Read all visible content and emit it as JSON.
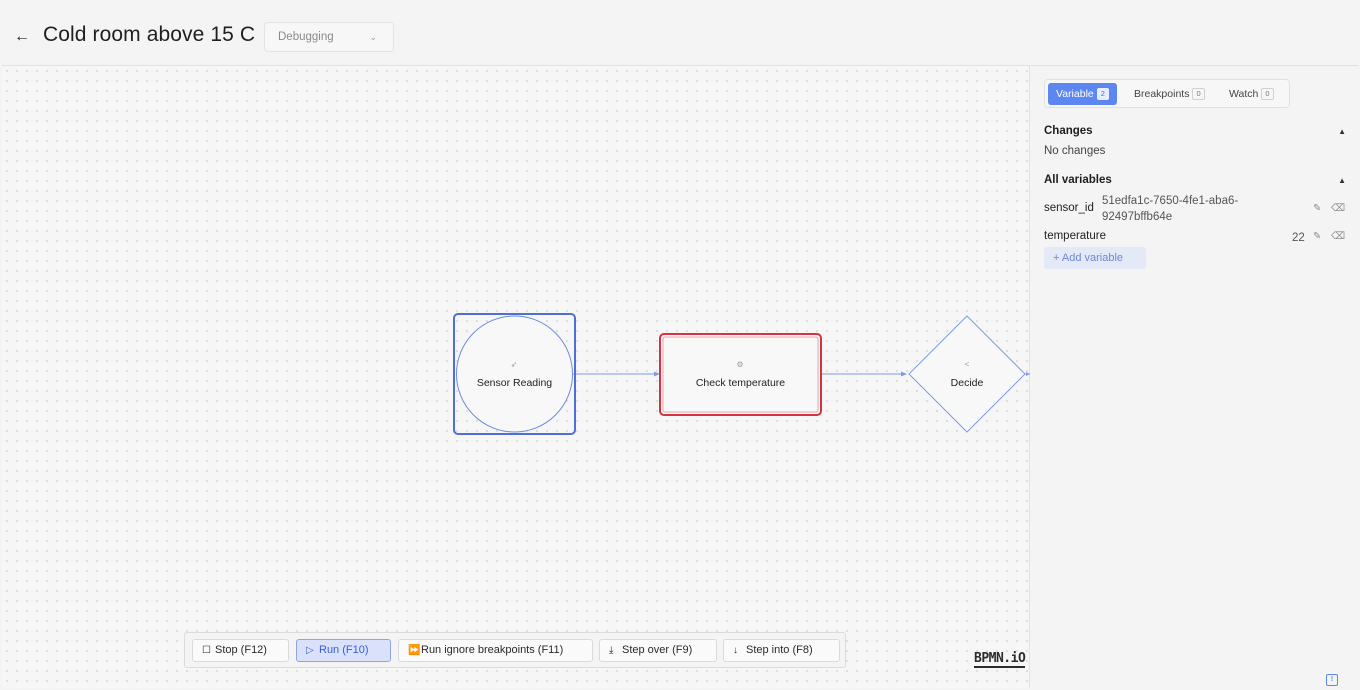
{
  "header": {
    "back_icon": "←",
    "title": "Cold room above 15 C",
    "mode_select": {
      "value": "Debugging",
      "chevron": "⌄"
    }
  },
  "diagram": {
    "nodes": [
      {
        "id": "start",
        "label": "Sensor Reading",
        "glyph": "➶"
      },
      {
        "id": "task",
        "label": "Check temperature",
        "glyph": "⚙"
      },
      {
        "id": "gateway",
        "label": "Decide",
        "glyph": "<"
      }
    ]
  },
  "toolbar": {
    "stop": {
      "icon": "☐",
      "label": "Stop (F12)"
    },
    "run": {
      "icon": "▷",
      "label": "Run (F10)"
    },
    "run_ignore": {
      "icon": "⏩",
      "label": "Run ignore breakpoints (F11)"
    },
    "step_over": {
      "icon": "⤓",
      "label": "Step over (F9)"
    },
    "step_into": {
      "icon": "↓",
      "label": "Step into (F8)"
    }
  },
  "logo": {
    "text": "BPMN.iO"
  },
  "panel": {
    "tabs": [
      {
        "label": "Variable",
        "count": "2"
      },
      {
        "label": "Breakpoints",
        "count": "0"
      },
      {
        "label": "Watch",
        "count": "0"
      }
    ],
    "changes": {
      "title": "Changes",
      "toggle": "▲",
      "empty": "No changes"
    },
    "all_variables": {
      "title": "All variables",
      "toggle": "▲",
      "items": [
        {
          "name": "sensor_id",
          "value_line1": "51edfa1c-7650-4fe1-aba6-",
          "value_line2": "92497bffb64e"
        },
        {
          "name": "temperature",
          "value": "22"
        }
      ],
      "edit_icon": "✎",
      "delete_icon": "⌫"
    },
    "add_variable": {
      "icon": "+",
      "label": "Add variable"
    }
  },
  "colors": {
    "accent": "#5c86f0",
    "start_selected": "#4f6fd4",
    "task_error": "#d9323f",
    "flow_line": "#7f9be6"
  }
}
